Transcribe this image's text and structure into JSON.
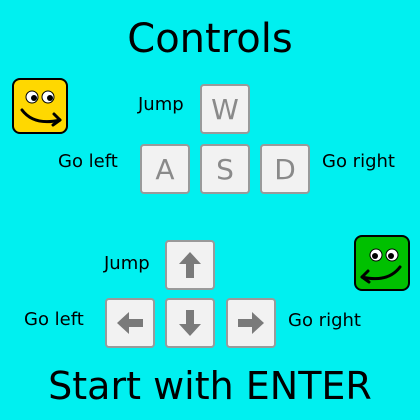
{
  "title": "Controls",
  "footer": "Start with ENTER",
  "player1": {
    "color": "#ffd800",
    "icon": "yellow-smiley-face-icon",
    "jump_label": "Jump",
    "left_label": "Go left",
    "right_label": "Go right",
    "keys": {
      "up": "W",
      "left": "A",
      "down": "S",
      "right": "D"
    }
  },
  "player2": {
    "color": "#00c000",
    "icon": "green-smiley-face-icon",
    "jump_label": "Jump",
    "left_label": "Go left",
    "right_label": "Go right",
    "keys": {
      "up": "arrow-up-icon",
      "left": "arrow-left-icon",
      "down": "arrow-down-icon",
      "right": "arrow-right-icon"
    }
  }
}
